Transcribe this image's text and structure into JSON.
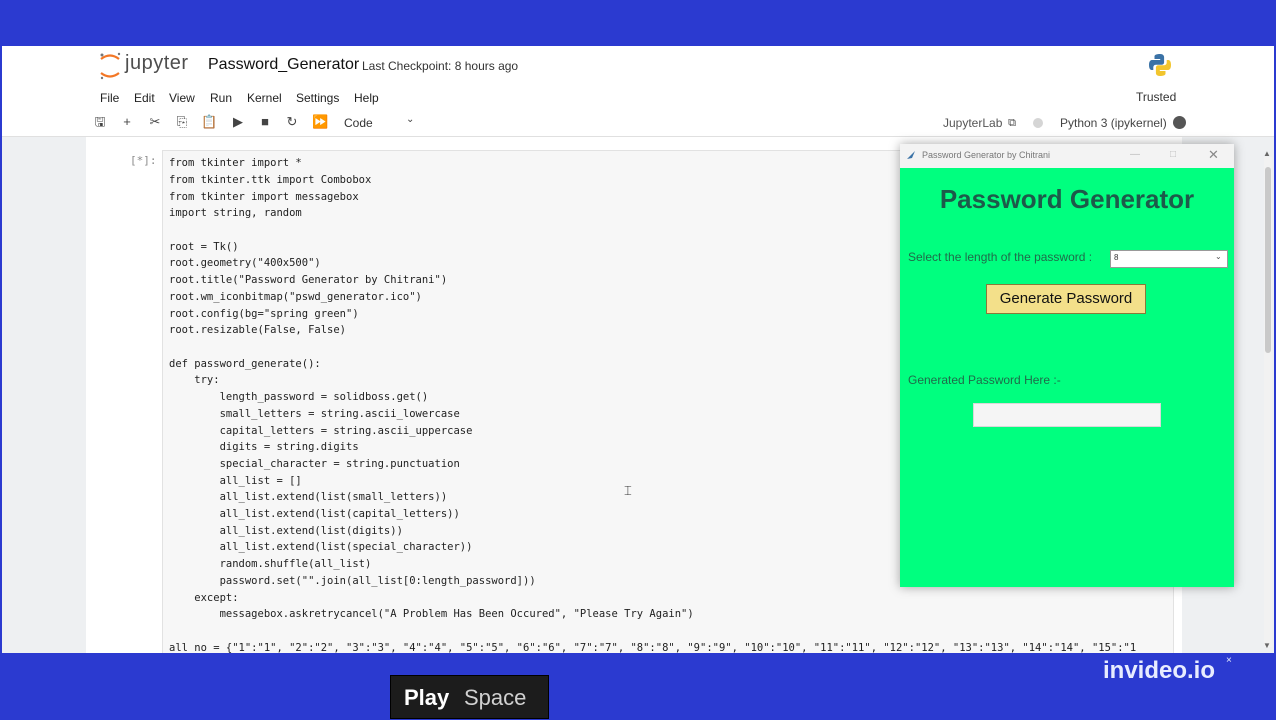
{
  "jupyter": {
    "logo_text": "jupyter",
    "notebook_title": "Password_Generator",
    "checkpoint": "Last Checkpoint: 8 hours ago",
    "menu": [
      "File",
      "Edit",
      "View",
      "Run",
      "Kernel",
      "Settings",
      "Help"
    ],
    "trusted": "Trusted",
    "cell_type": "Code",
    "jupyterlab_link": "JupyterLab",
    "kernel_name": "Python 3 (ipykernel)"
  },
  "cell": {
    "prompt": "[*]:",
    "code_lines": [
      "from tkinter import *",
      "from tkinter.ttk import Combobox",
      "from tkinter import messagebox",
      "import string, random",
      "",
      "root = Tk()",
      "root.geometry(\"400x500\")",
      "root.title(\"Password Generator by Chitrani\")",
      "root.wm_iconbitmap(\"pswd_generator.ico\")",
      "root.config(bg=\"spring green\")",
      "root.resizable(False, False)",
      "",
      "def password_generate():",
      "    try:",
      "        length_password = solidboss.get()",
      "        small_letters = string.ascii_lowercase",
      "        capital_letters = string.ascii_uppercase",
      "        digits = string.digits",
      "        special_character = string.punctuation",
      "        all_list = []",
      "        all_list.extend(list(small_letters))",
      "        all_list.extend(list(capital_letters))",
      "        all_list.extend(list(digits))",
      "        all_list.extend(list(special_character))",
      "        random.shuffle(all_list)",
      "        password.set(\"\".join(all_list[0:length_password]))",
      "    except:",
      "        messagebox.askretrycancel(\"A Problem Has Been Occured\", \"Please Try Again\")",
      "",
      "all_no = {\"1\":\"1\", \"2\":\"2\", \"3\":\"3\", \"4\":\"4\", \"5\":\"5\", \"6\":\"6\", \"7\":\"7\", \"8\":\"8\", \"9\":\"9\", \"10\":\"10\", \"11\":\"11\", \"12\":\"12\", \"13\":\"13\", \"14\":\"14\", \"15\":\"1"
    ]
  },
  "tk_window": {
    "title": "Password Generator by Chitrani",
    "heading": "Password Generator",
    "select_label": "Select the length of the password :",
    "combo_value": "8",
    "button_label": "Generate Password",
    "output_label": "Generated Password Here :-",
    "output_value": "",
    "bg_color": "#00ff7f"
  },
  "overlay": {
    "play": "Play",
    "space": "Space",
    "brand": "invideo.io",
    "brand_mark": "×"
  },
  "colors": {
    "band": "#2b3ad0",
    "keyword": "#008000",
    "string": "#ba2121",
    "tk_button": "#f3e08a",
    "tk_heading": "#1d5a4a"
  }
}
